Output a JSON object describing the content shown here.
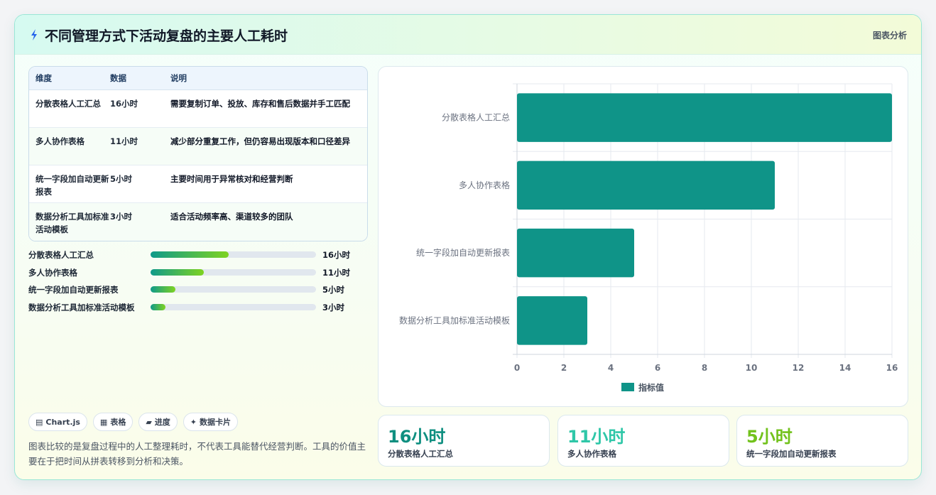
{
  "header": {
    "title": "不同管理方式下活动复盘的主要人工耗时",
    "tag": "图表分析"
  },
  "table": {
    "headers": [
      "维度",
      "数据",
      "说明"
    ],
    "rows": [
      [
        "分散表格人工汇总",
        "16小时",
        "需要复制订单、投放、库存和售后数据并手工匹配"
      ],
      [
        "多人协作表格",
        "11小时",
        "减少部分重复工作，但仍容易出现版本和口径差异"
      ],
      [
        "统一字段加自动更新报表",
        "5小时",
        "主要时间用于异常核对和经营判断"
      ],
      [
        "数据分析工具加标准活动模板",
        "3小时",
        "适合活动频率高、渠道较多的团队"
      ]
    ]
  },
  "progress": [
    {
      "label": "分散表格人工汇总",
      "value": "16小时",
      "fraction": 0.47
    },
    {
      "label": "多人协作表格",
      "value": "11小时",
      "fraction": 0.32
    },
    {
      "label": "统一字段加自动更新报表",
      "value": "5小时",
      "fraction": 0.15
    },
    {
      "label": "数据分析工具加标准活动模板",
      "value": "3小时",
      "fraction": 0.09
    }
  ],
  "chips": [
    {
      "icon": "chart-icon",
      "label": "Chart.js"
    },
    {
      "icon": "table-icon",
      "label": "表格"
    },
    {
      "icon": "progress-icon",
      "label": "进度"
    },
    {
      "icon": "sparkle-icon",
      "label": "数据卡片"
    }
  ],
  "note": "图表比较的是复盘过程中的人工整理耗时，不代表工具能替代经营判断。工具的价值主要在于把时间从拼表转移到分析和决策。",
  "stats": [
    {
      "value": "16小时",
      "label": "分散表格人工汇总",
      "color": "#0f8f80"
    },
    {
      "value": "11小时",
      "label": "多人协作表格",
      "color": "#2fc7a8"
    },
    {
      "value": "5小时",
      "label": "统一字段加自动更新报表",
      "color": "#72c21c"
    }
  ],
  "colors": {
    "bar": "#0f9488",
    "accent": "#0f8f80"
  },
  "chart_data": {
    "type": "bar",
    "orientation": "horizontal",
    "categories": [
      "分散表格人工汇总",
      "多人协作表格",
      "统一字段加自动更新报表",
      "数据分析工具加标准活动模板"
    ],
    "series": [
      {
        "name": "指标值",
        "values": [
          16,
          11,
          5,
          3
        ]
      }
    ],
    "xlim": [
      0,
      16
    ],
    "xticks": [
      0,
      2,
      4,
      6,
      8,
      10,
      12,
      14,
      16
    ],
    "grid": true,
    "legend": "bottom"
  }
}
